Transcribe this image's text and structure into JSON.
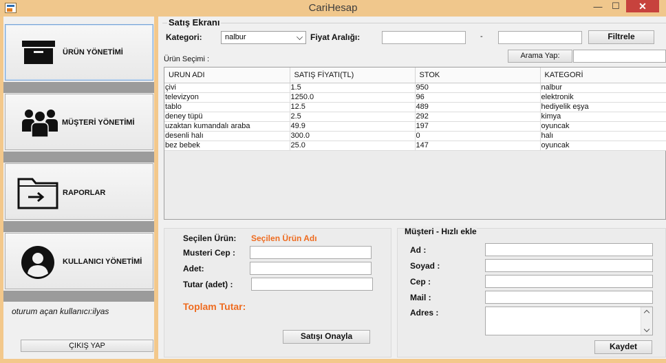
{
  "window": {
    "title": "CariHesap",
    "minimize": "—",
    "maximize": "☐",
    "close": "✕"
  },
  "sidebar": {
    "items": [
      {
        "label": "ÜRÜN YÖNETİMİ",
        "icon": "box-icon"
      },
      {
        "label": "MÜŞTERİ YÖNETİMİ",
        "icon": "users-icon"
      },
      {
        "label": "RAPORLAR",
        "icon": "folder-export-icon"
      },
      {
        "label": "KULLANICI YÖNETİMİ",
        "icon": "user-icon"
      }
    ],
    "session": "oturum açan kullanıcı:ilyas",
    "logout": "ÇIKIŞ YAP"
  },
  "sales": {
    "title": "Satış Ekranı",
    "category_label": "Kategori:",
    "category_value": "nalbur",
    "price_range_label": "Fiyat Aralığı:",
    "price_min": "",
    "range_sep": "-",
    "price_max": "",
    "filter_button": "Filtrele",
    "product_selection": "Ürün Seçimi :",
    "search_label": "Arama Yap:",
    "search_value": ""
  },
  "table": {
    "columns": [
      "URUN ADI",
      "SATIŞ FİYATI(TL)",
      "STOK",
      "KATEGORİ"
    ],
    "rows": [
      [
        "çivi",
        "1.5",
        "950",
        "nalbur"
      ],
      [
        "televizyon",
        "1250.0",
        "96",
        "elektronik"
      ],
      [
        "tablo",
        "12.5",
        "489",
        "hediyelik eşya"
      ],
      [
        "deney tüpü",
        "2.5",
        "292",
        "kimya"
      ],
      [
        "uzaktan kumandalı araba",
        "49.9",
        "197",
        "oyuncak"
      ],
      [
        "desenli halı",
        "300.0",
        "0",
        "halı"
      ],
      [
        "bez bebek",
        "25.0",
        "147",
        "oyuncak"
      ]
    ]
  },
  "order": {
    "selected_label": "Seçilen Ürün:",
    "selected_value": "Seçilen Ürün Adı",
    "phone_label": "Musteri Cep :",
    "qty_label": "Adet:",
    "amount_label": "Tutar (adet) :",
    "total_label": "Toplam Tutar:",
    "confirm_button": "Satışı Onayla"
  },
  "customer": {
    "title": "Müşteri - Hızlı ekle",
    "name_label": "Ad :",
    "surname_label": "Soyad :",
    "phone_label": "Cep :",
    "mail_label": "Mail :",
    "address_label": "Adres :",
    "save_button": "Kaydet"
  },
  "colors": {
    "accent": "#ee6b1f",
    "window_frame": "#f0c78c",
    "close": "#c7423d"
  }
}
